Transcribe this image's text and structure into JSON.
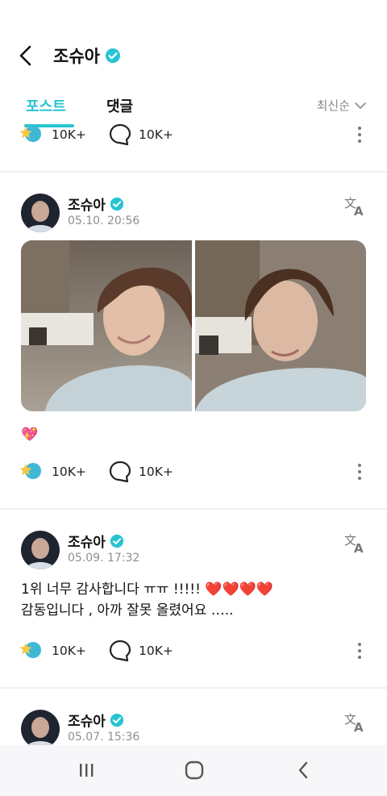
{
  "header": {
    "title": "조슈아"
  },
  "tabs": [
    {
      "label": "포스트"
    },
    {
      "label": "댓글"
    }
  ],
  "sort": {
    "label": "최신순"
  },
  "posts": [
    {
      "likes": "10K+",
      "comments": "10K+"
    },
    {
      "author": "조슈아",
      "date": "05.10. 20:56",
      "text": "💖",
      "likes": "10K+",
      "comments": "10K+"
    },
    {
      "author": "조슈아",
      "date": "05.09. 17:32",
      "line1": "1위 너무 감사합니다 ㅠㅠ !!!!! ❤️❤️❤️❤️",
      "line2": "감동입니다 , 아까 잘못 올렸어요 …..",
      "likes": "10K+",
      "comments": "10K+"
    },
    {
      "author": "조슈아",
      "date": "05.07. 15:36"
    }
  ],
  "colors": {
    "accent": "#27c4d2",
    "heart": "#e0245e"
  }
}
